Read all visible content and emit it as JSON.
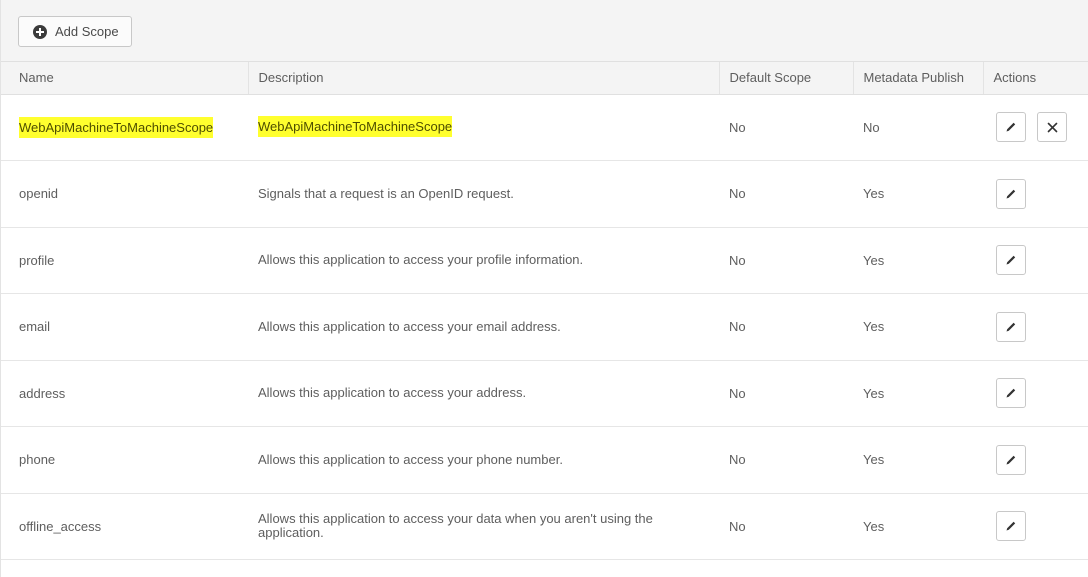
{
  "toolbar": {
    "add_scope_label": "Add Scope",
    "add_icon": "plus-circle-icon"
  },
  "table": {
    "headers": {
      "name": "Name",
      "description": "Description",
      "default_scope": "Default Scope",
      "metadata_publish": "Metadata Publish",
      "actions": "Actions"
    },
    "rows": [
      {
        "name": "WebApiMachineToMachineScope",
        "description": "WebApiMachineToMachineScope",
        "default_scope": "No",
        "metadata_publish": "No",
        "highlighted": true,
        "deletable": true
      },
      {
        "name": "openid",
        "description": "Signals that a request is an OpenID request.",
        "default_scope": "No",
        "metadata_publish": "Yes",
        "highlighted": false,
        "deletable": false
      },
      {
        "name": "profile",
        "description": "Allows this application to access your profile information.",
        "default_scope": "No",
        "metadata_publish": "Yes",
        "highlighted": false,
        "deletable": false
      },
      {
        "name": "email",
        "description": "Allows this application to access your email address.",
        "default_scope": "No",
        "metadata_publish": "Yes",
        "highlighted": false,
        "deletable": false
      },
      {
        "name": "address",
        "description": "Allows this application to access your address.",
        "default_scope": "No",
        "metadata_publish": "Yes",
        "highlighted": false,
        "deletable": false
      },
      {
        "name": "phone",
        "description": "Allows this application to access your phone number.",
        "default_scope": "No",
        "metadata_publish": "Yes",
        "highlighted": false,
        "deletable": false
      },
      {
        "name": "offline_access",
        "description": "Allows this application to access your data when you aren't using the application.",
        "default_scope": "No",
        "metadata_publish": "Yes",
        "highlighted": false,
        "deletable": false
      }
    ],
    "action_icons": {
      "edit": "pencil-icon",
      "delete": "close-icon"
    }
  },
  "colors": {
    "highlight": "#ffff2e",
    "header_bg": "#f4f4f4",
    "text": "#5e5e5e"
  }
}
